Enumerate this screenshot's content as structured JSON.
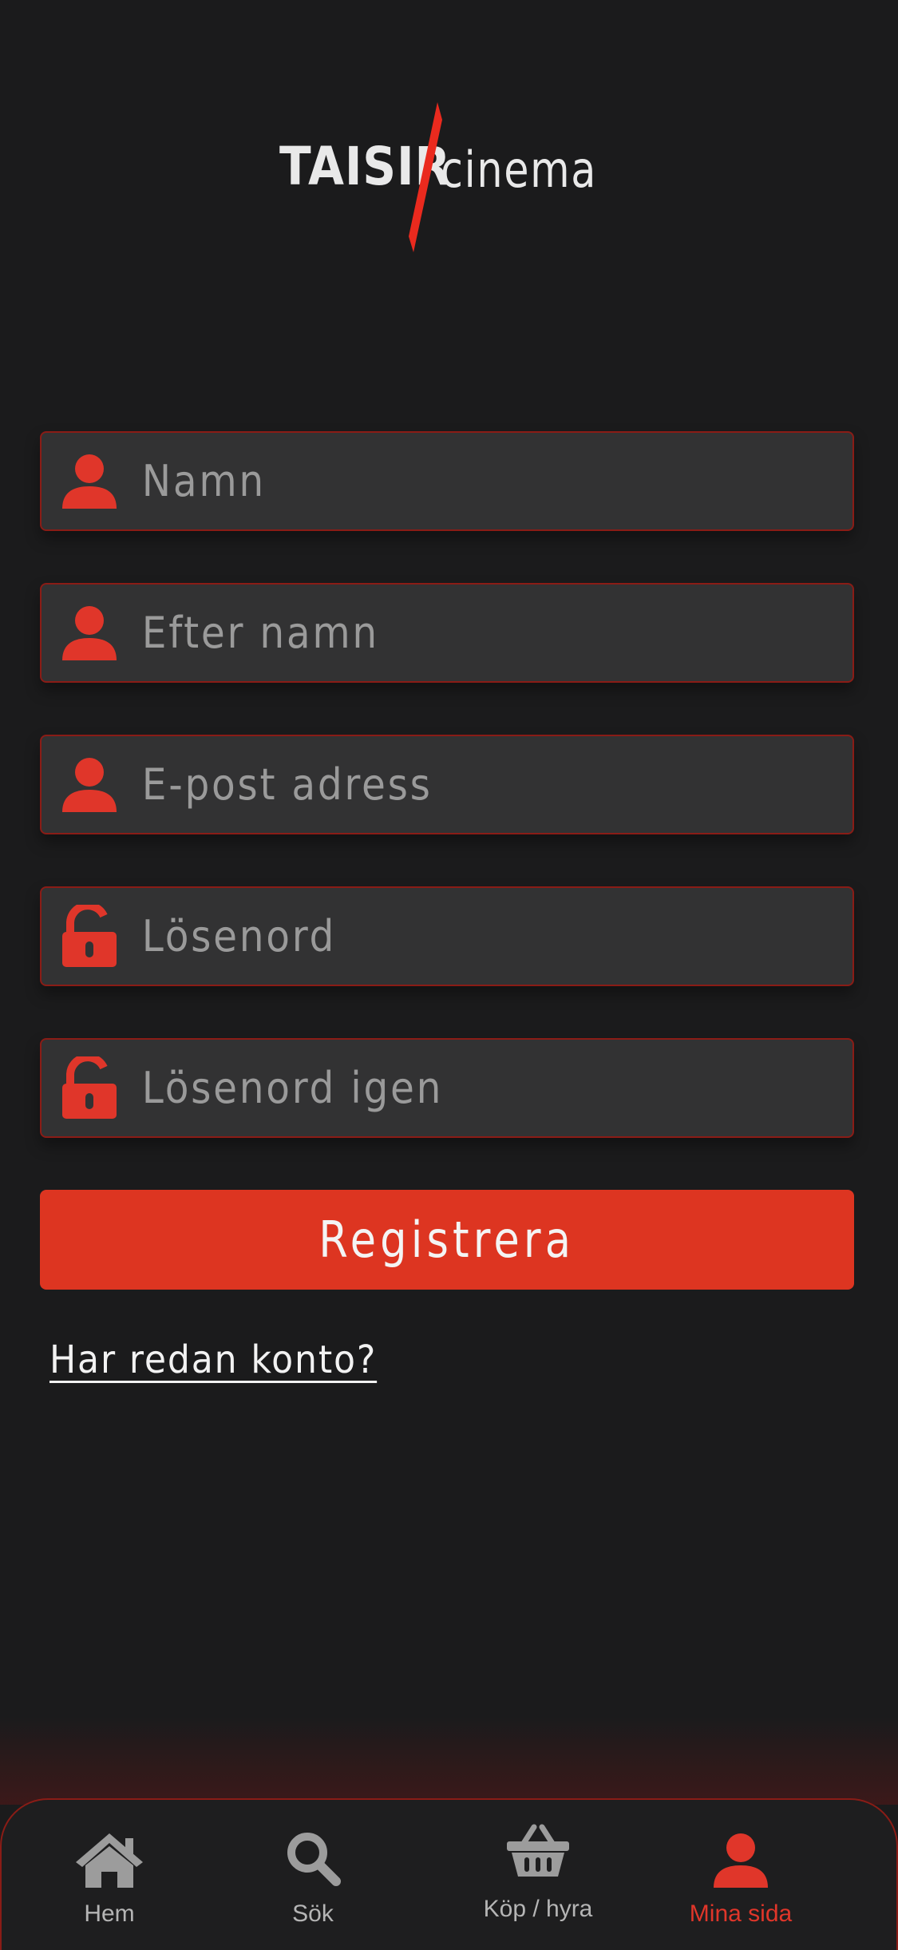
{
  "brand": {
    "name_left": "TAISIR",
    "name_right": "cinema",
    "accent_color": "#dd3521"
  },
  "form": {
    "fields": [
      {
        "placeholder": "Namn",
        "icon": "user-icon",
        "type": "text"
      },
      {
        "placeholder": "Efter namn",
        "icon": "user-icon",
        "type": "text"
      },
      {
        "placeholder": "E-post adress",
        "icon": "user-icon",
        "type": "email"
      },
      {
        "placeholder": "Lösenord",
        "icon": "unlock-icon",
        "type": "password"
      },
      {
        "placeholder": "Lösenord igen",
        "icon": "unlock-icon",
        "type": "password"
      }
    ],
    "submit_label": "Registrera",
    "login_link": "Har redan konto?"
  },
  "nav": {
    "items": [
      {
        "label": "Hem",
        "icon": "home-icon",
        "active": false
      },
      {
        "label": "Sök",
        "icon": "search-icon",
        "active": false
      },
      {
        "label": "Köp / hyra",
        "icon": "basket-icon",
        "active": false
      },
      {
        "label": "Mina sida",
        "icon": "user-icon",
        "active": true
      }
    ],
    "active_color": "#e0362a",
    "inactive_color": "#b5b5b5"
  }
}
